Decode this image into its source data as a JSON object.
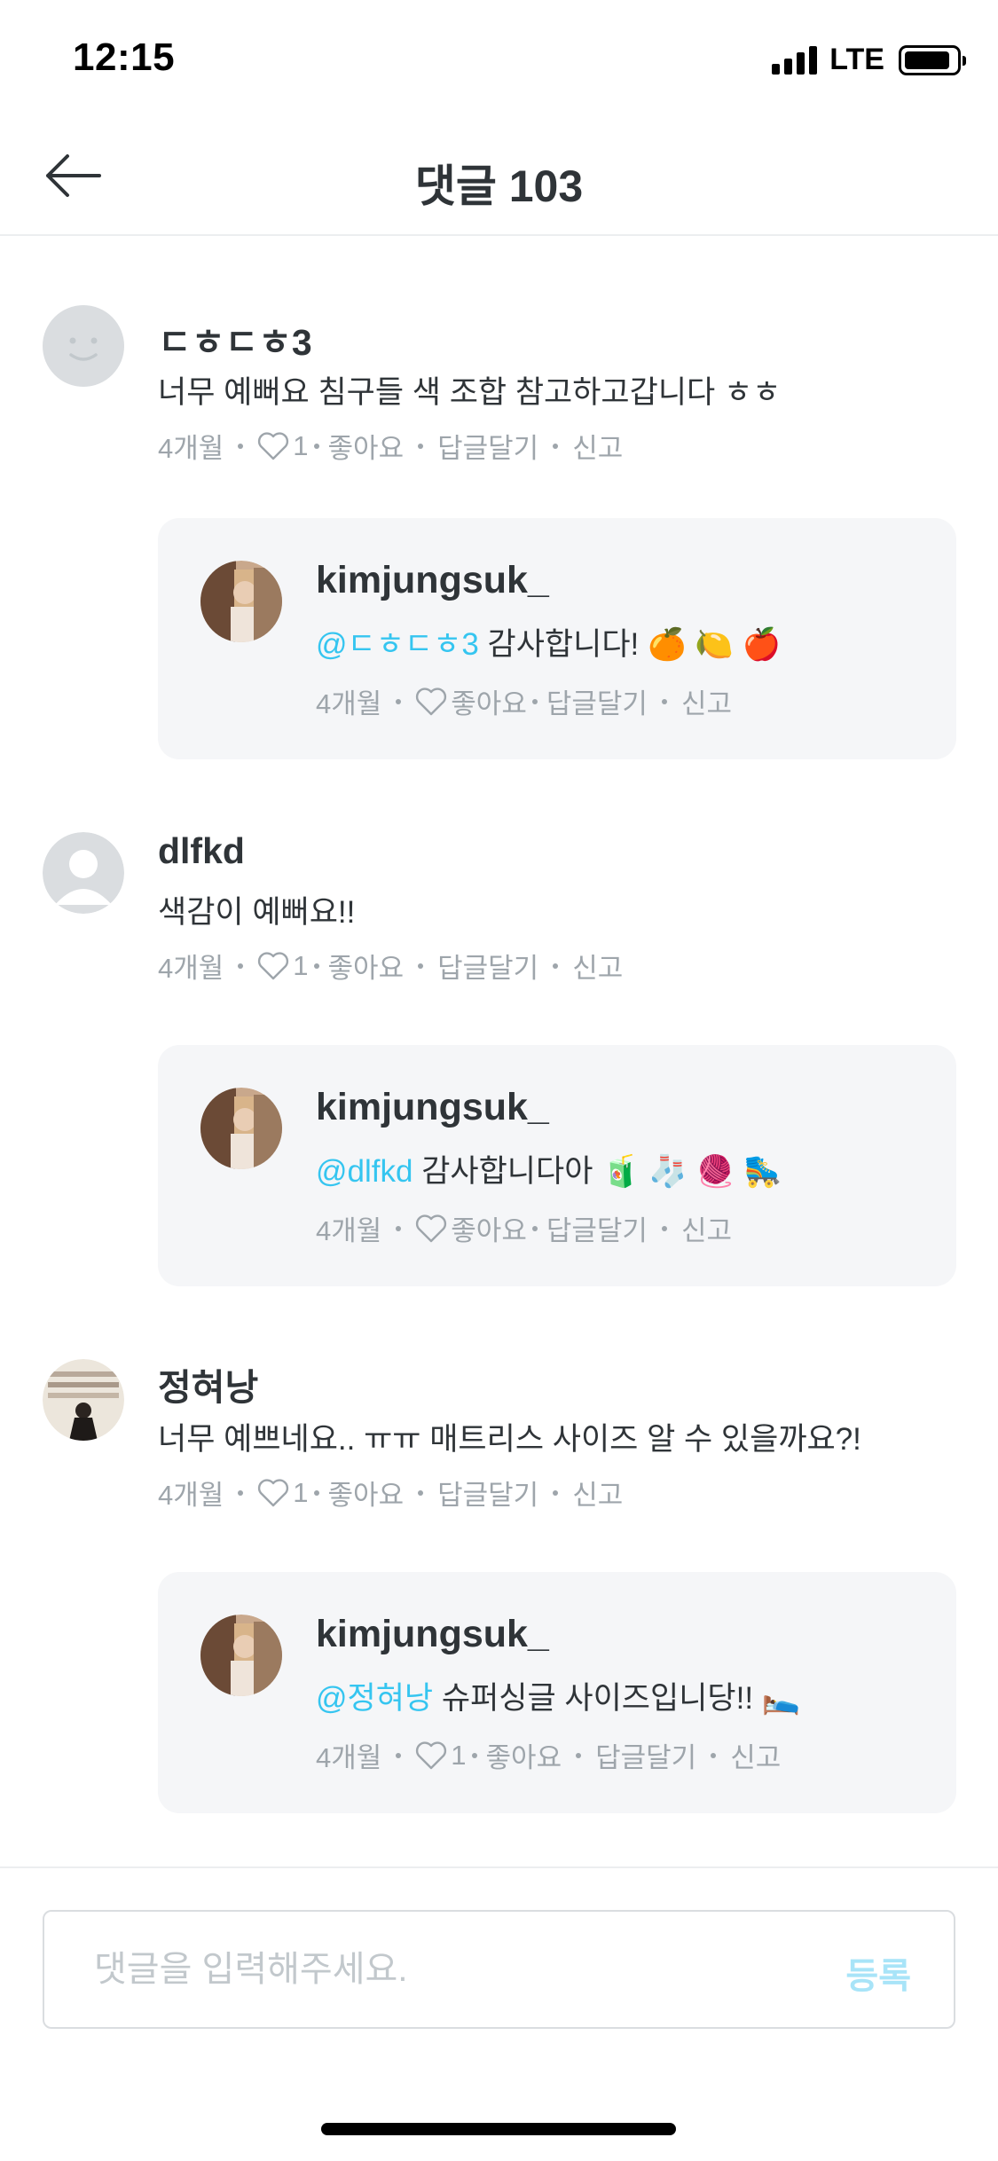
{
  "status_bar": {
    "time": "12:15",
    "network": "LTE"
  },
  "header": {
    "title": "댓글 103",
    "back_icon": "arrow-left-icon"
  },
  "comments": [
    {
      "author": "ㄷㅎㄷㅎ3",
      "text": "너무 예뻐요 침구들 색 조합 참고하고갑니다 ㅎㅎ",
      "avatar": "default-smiley-avatar",
      "meta": {
        "time": "4개월",
        "likes": "1",
        "like_label": "좋아요",
        "reply_label": "답글달기",
        "report_label": "신고"
      },
      "reply": {
        "author": "kimjungsuk_",
        "mention": "@ㄷㅎㄷㅎ3",
        "text": "감사합니다! 🍊 🍋 🍎",
        "meta": {
          "time": "4개월",
          "like_label": "좋아요",
          "reply_label": "답글달기",
          "report_label": "신고"
        }
      }
    },
    {
      "author": "dlfkd",
      "text": "색감이 예뻐요!!",
      "avatar": "default-person-avatar",
      "meta": {
        "time": "4개월",
        "likes": "1",
        "like_label": "좋아요",
        "reply_label": "답글달기",
        "report_label": "신고"
      },
      "reply": {
        "author": "kimjungsuk_",
        "mention": "@dlfkd",
        "text": "감사합니다아 🧃 🧦 🧶 🛼",
        "meta": {
          "time": "4개월",
          "like_label": "좋아요",
          "reply_label": "답글달기",
          "report_label": "신고"
        }
      }
    },
    {
      "author": "정혀낭",
      "text": "너무 예쁘네요.. ㅠㅠ 매트리스 사이즈 알 수 있을까요?!",
      "avatar": "photo-avatar",
      "meta": {
        "time": "4개월",
        "likes": "1",
        "like_label": "좋아요",
        "reply_label": "답글달기",
        "report_label": "신고"
      },
      "reply": {
        "author": "kimjungsuk_",
        "mention": "@정혀낭",
        "text": "슈퍼싱글 사이즈입니당!! 🛌",
        "meta": {
          "time": "4개월",
          "likes": "1",
          "like_label": "좋아요",
          "reply_label": "답글달기",
          "report_label": "신고"
        }
      }
    }
  ],
  "composer": {
    "placeholder": "댓글을 입력해주세요.",
    "submit_label": "등록"
  },
  "colors": {
    "accent": "#35c5f0",
    "submit_disabled": "#a8e4f8",
    "reply_bg": "#f5f6f8",
    "meta_text": "#9ea5ab"
  }
}
